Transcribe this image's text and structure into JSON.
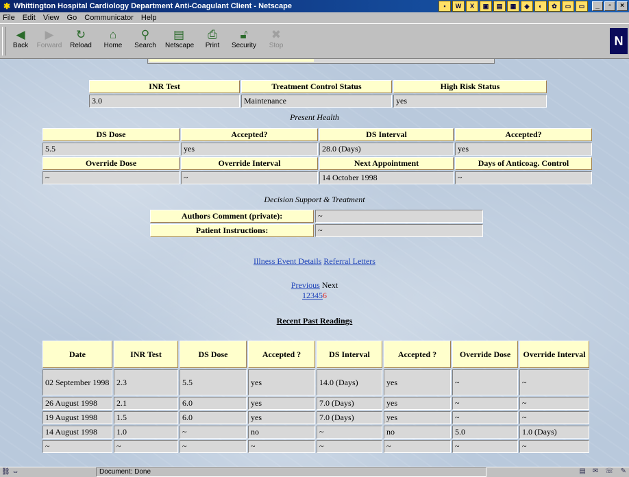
{
  "window": {
    "title": "Whittington Hospital Cardiology Department Anti-Coagulant Client - Netscape"
  },
  "menu": [
    "File",
    "Edit",
    "View",
    "Go",
    "Communicator",
    "Help"
  ],
  "toolbar": {
    "buttons": [
      {
        "label": "Back",
        "icon": "back-arrow-icon",
        "enabled": true
      },
      {
        "label": "Forward",
        "icon": "forward-arrow-icon",
        "enabled": false
      },
      {
        "label": "Reload",
        "icon": "reload-icon",
        "enabled": true
      },
      {
        "label": "Home",
        "icon": "home-icon",
        "enabled": true
      },
      {
        "label": "Search",
        "icon": "search-icon",
        "enabled": true
      },
      {
        "label": "Netscape",
        "icon": "netscape-icon",
        "enabled": true
      },
      {
        "label": "Print",
        "icon": "print-icon",
        "enabled": true
      },
      {
        "label": "Security",
        "icon": "security-lock-icon",
        "enabled": true
      },
      {
        "label": "Stop",
        "icon": "stop-icon",
        "enabled": false
      }
    ],
    "logo": "N"
  },
  "status_table": {
    "headers": [
      "INR Test",
      "Treatment Control Status",
      "High Risk Status"
    ],
    "values": [
      "3.0",
      "Maintenance",
      "yes"
    ]
  },
  "present_health_label": "Present Health",
  "dose_table": {
    "row1_headers": [
      "DS Dose",
      "Accepted?",
      "DS Interval",
      "Accepted?"
    ],
    "row1_values": [
      "5.5",
      "yes",
      "28.0 (Days)",
      "yes"
    ],
    "row2_headers": [
      "Override Dose",
      "Override Interval",
      "Next Appointment",
      "Days of Anticoag. Control"
    ],
    "row2_values": [
      "~",
      "~",
      "14 October 1998",
      "~"
    ]
  },
  "decision_label": "Decision Support & Treatment",
  "comments": {
    "authors_label": "Authors Comment (private):",
    "authors_value": "~",
    "patient_label": "Patient Instructions:",
    "patient_value": "~"
  },
  "links": {
    "illness": "Illness Event Details",
    "referral": "Referral Letters"
  },
  "pager": {
    "previous": "Previous",
    "next": "Next",
    "pages": [
      "1",
      "2",
      "3",
      "4",
      "5"
    ],
    "current": "6"
  },
  "recent": {
    "title": "Recent Past Readings",
    "headers": [
      "Date",
      "INR Test",
      "DS Dose",
      "Accepted ?",
      "DS Interval",
      "Accepted ?",
      "Override Dose",
      "Override Interval"
    ],
    "rows": [
      [
        "02 September 1998",
        "2.3",
        "5.5",
        "yes",
        "14.0 (Days)",
        "yes",
        "~",
        "~"
      ],
      [
        "26 August 1998",
        "2.1",
        "6.0",
        "yes",
        "7.0 (Days)",
        "yes",
        "~",
        "~"
      ],
      [
        "19 August 1998",
        "1.5",
        "6.0",
        "yes",
        "7.0 (Days)",
        "yes",
        "~",
        "~"
      ],
      [
        "14 August 1998",
        "1.0",
        "~",
        "no",
        "~",
        "no",
        "5.0",
        "1.0 (Days)"
      ],
      [
        "~",
        "~",
        "~",
        "~",
        "~",
        "~",
        "~",
        "~"
      ]
    ]
  },
  "status": {
    "message": "Document: Done"
  }
}
